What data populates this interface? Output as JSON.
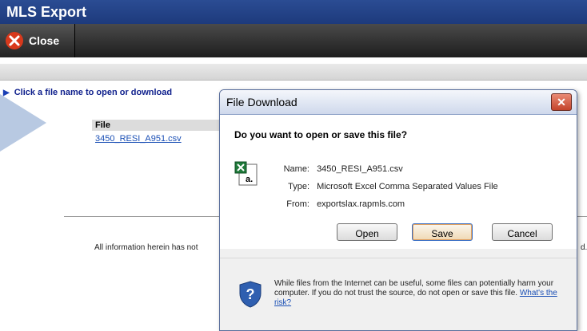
{
  "app": {
    "title": "MLS Export"
  },
  "toolbar": {
    "close_label": "Close"
  },
  "instruction": "Click a file name to open or download",
  "files": {
    "header": "File",
    "items": [
      "3450_RESI_A951.csv"
    ]
  },
  "disclaimer": {
    "start": "All information herein has not",
    "end": "d."
  },
  "dialog": {
    "title": "File Download",
    "close_glyph": "✕",
    "question": "Do you want to open or save this file?",
    "name_label": "Name:",
    "name_value": "3450_RESI_A951.csv",
    "type_label": "Type:",
    "type_value": "Microsoft Excel Comma Separated Values File",
    "from_label": "From:",
    "from_value": "exportslax.rapmls.com",
    "open_label": "Open",
    "save_label": "Save",
    "cancel_label": "Cancel",
    "warning_text": "While files from the Internet can be useful, some files can potentially harm your computer. If you do not trust the source, do not open or save this file.",
    "risk_link": "What's the risk?"
  },
  "colors": {
    "titlebar": "#1d3a7c",
    "link": "#1a4fb5",
    "dialog_close": "#c4442b"
  }
}
